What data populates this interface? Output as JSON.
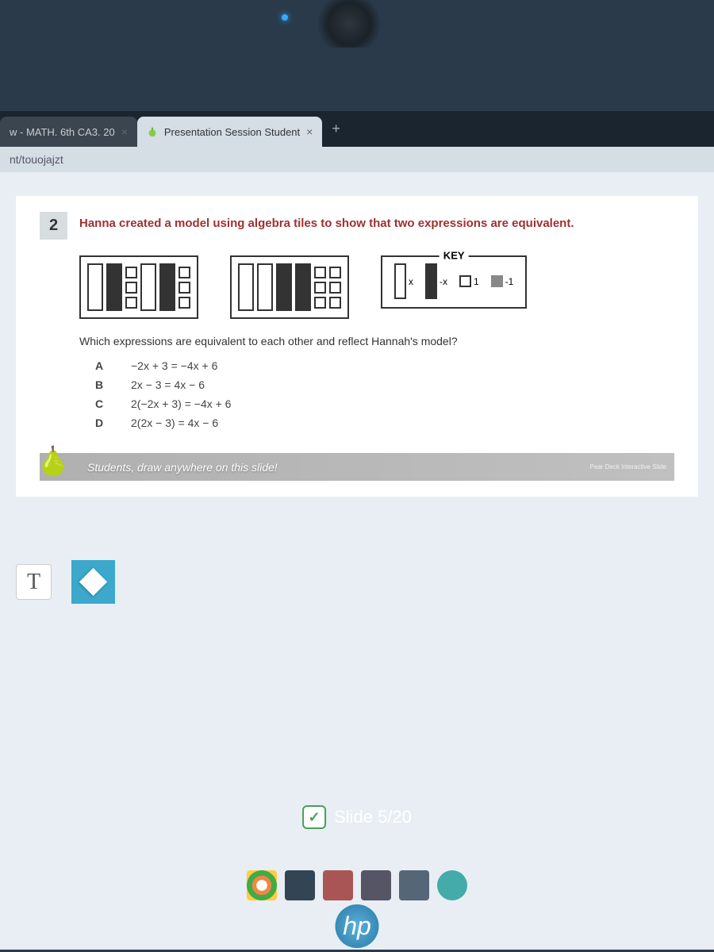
{
  "tabs": {
    "inactive_label": "w - MATH. 6th CA3. 20",
    "active_label": "Presentation Session Student"
  },
  "url": "nt/touojajzt",
  "question": {
    "number": "2",
    "text": "Hanna created a model using algebra tiles to show that two expressions are equivalent.",
    "sub": "Which expressions are equivalent to each other and reflect Hannah's model?"
  },
  "key": {
    "label": "KEY",
    "x": "x",
    "negx": "-x",
    "one": "1",
    "negone": "-1"
  },
  "choices": {
    "a_letter": "A",
    "a_text": "−2x + 3 = −4x + 6",
    "b_letter": "B",
    "b_text": "2x − 3 = 4x − 6",
    "c_letter": "C",
    "c_text": "2(−2x + 3) = −4x + 6",
    "d_letter": "D",
    "d_text": "2(2x − 3) = 4x − 6"
  },
  "instruction": {
    "text": "Students, draw anywhere on this slide!",
    "right": "Pear Deck Interactive Slide"
  },
  "slide_indicator": "Slide 5/20",
  "hp": "hp",
  "text_tool": "T"
}
